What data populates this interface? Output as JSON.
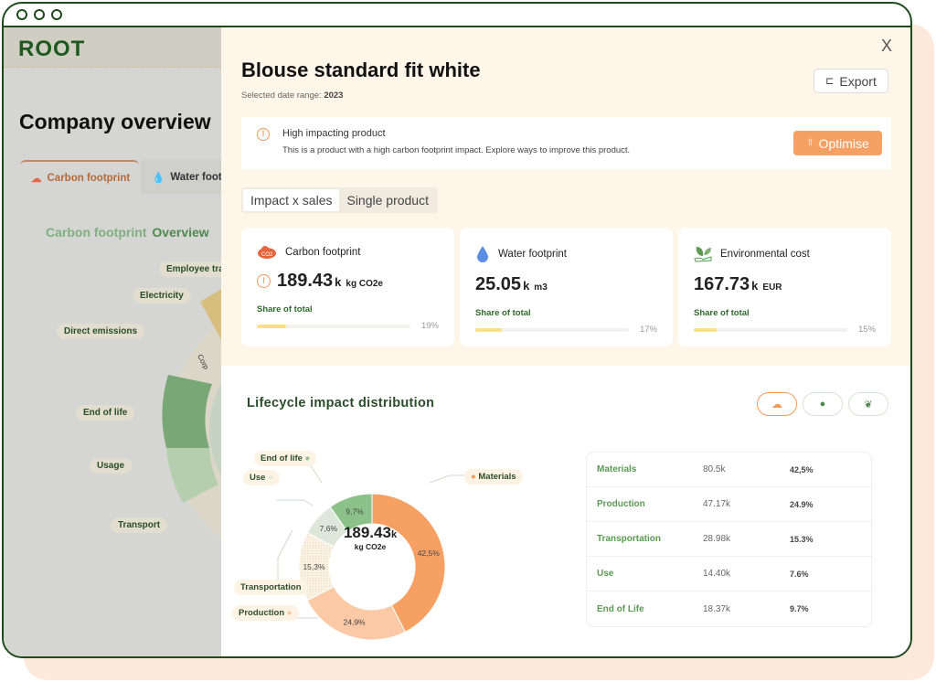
{
  "app": {
    "logo": "ROOT"
  },
  "background": {
    "title": "Company overview",
    "tabs": [
      {
        "label": "Carbon footprint",
        "icon": "co2-cloud-icon"
      },
      {
        "label": "Water footp",
        "icon": "water-drop-icon"
      }
    ],
    "chart_title_a": "Carbon footprint",
    "chart_title_b": "Overview",
    "labels": [
      "Employee trav",
      "Electricity",
      "Direct emissions",
      "End of life",
      "Usage",
      "Transport"
    ],
    "ring_text": "Corp"
  },
  "panel": {
    "close": "X",
    "title": "Blouse standard fit white",
    "date_range_label": "Selected date range:",
    "date_range": "2023",
    "export": "Export",
    "alert": {
      "title": "High impacting product",
      "text": "This is a product with a high carbon footprint impact. Explore ways to improve this product.",
      "action": "Optimise"
    },
    "view_tabs": [
      "Impact x sales",
      "Single product"
    ],
    "active_view": "Impact x sales",
    "cards": [
      {
        "title": "Carbon footprint",
        "icon": "co2-cloud-icon",
        "value": "189.43",
        "suffix": "k",
        "unit": "kg CO2e",
        "warning": true,
        "share_label": "Share of total",
        "share": 19,
        "share_text": "19%"
      },
      {
        "title": "Water footprint",
        "icon": "water-drop-icon",
        "value": "25.05",
        "suffix": "k",
        "unit": "m3",
        "warning": false,
        "share_label": "Share of total",
        "share": 17,
        "share_text": "17%"
      },
      {
        "title": "Environmental cost",
        "icon": "leaf-hand-icon",
        "value": "167.73",
        "suffix": "k",
        "unit": "EUR",
        "warning": false,
        "share_label": "Share of total",
        "share": 15,
        "share_text": "15%"
      }
    ],
    "lifecycle": {
      "title": "Lifecycle impact distribution",
      "metric_buttons": [
        "co2-cloud-icon",
        "water-drop-icon",
        "leaf-hand-icon"
      ],
      "center_value": "189.43",
      "center_suffix": "k",
      "center_unit": "kg CO2e",
      "table": [
        {
          "name": "Materials",
          "value": "80.5k",
          "pct": "42,5%"
        },
        {
          "name": "Production",
          "value": "47.17k",
          "pct": "24.9%"
        },
        {
          "name": "Transportation",
          "value": "28.98k",
          "pct": "15.3%"
        },
        {
          "name": "Use",
          "value": "14.40k",
          "pct": "7.6%"
        },
        {
          "name": "End of Life",
          "value": "18.37k",
          "pct": "9.7%"
        }
      ]
    }
  },
  "chart_data": {
    "type": "pie",
    "categories": [
      "Materials",
      "Production",
      "Transportation",
      "Use",
      "End of life"
    ],
    "values": [
      42.5,
      24.9,
      15.3,
      7.6,
      9.7
    ],
    "data_labels": [
      "42,5%",
      "24,9%",
      "15,3%",
      "7,6%",
      "9,7%"
    ],
    "colors": [
      "#f7a064",
      "#fcc9a6",
      "#fbf1e2",
      "#dde8da",
      "#8cc28a"
    ]
  }
}
